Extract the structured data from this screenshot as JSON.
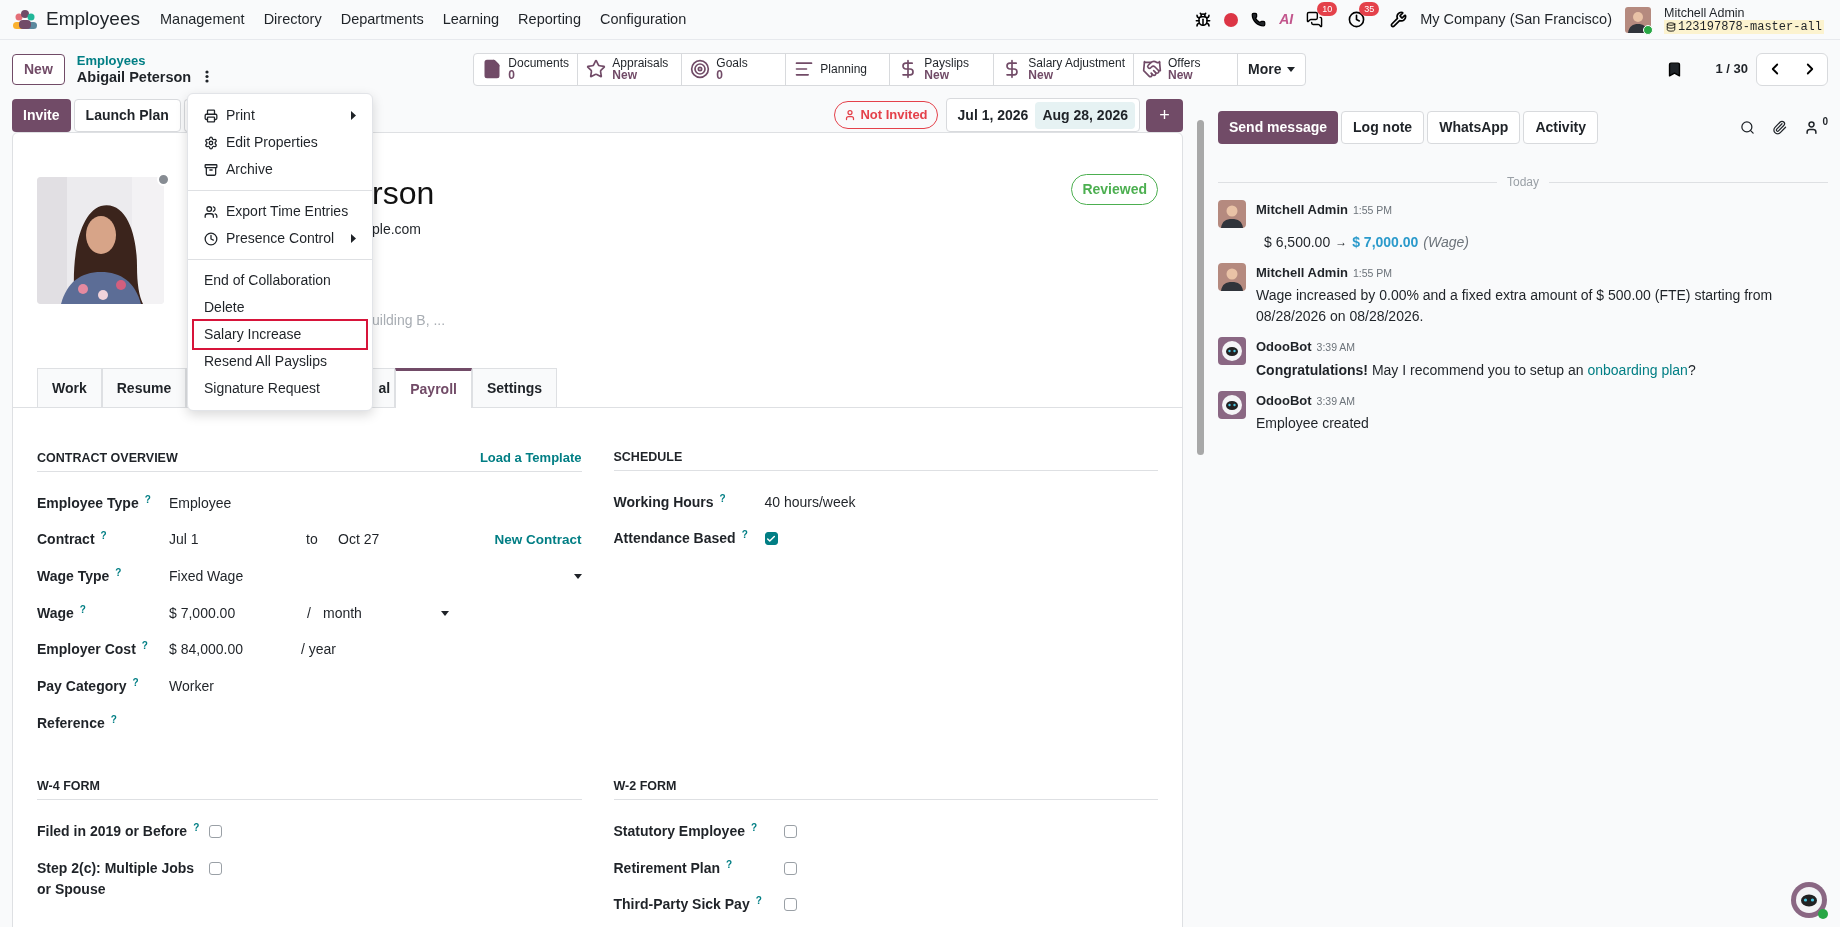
{
  "navbar": {
    "app_name": "Employees",
    "menu": [
      "Management",
      "Directory",
      "Departments",
      "Learning",
      "Reporting",
      "Configuration"
    ],
    "ai_label": "AI",
    "messages_count": "10",
    "activities_count": "35",
    "company": "My Company (San Francisco)",
    "user_name": "Mitchell Admin",
    "database": "123197878-master-all"
  },
  "control_panel": {
    "new_button": "New",
    "breadcrumb_parent": "Employees",
    "record_title": "Abigail Peterson",
    "smart_buttons": [
      {
        "label": "Documents",
        "value": "0",
        "kind": "document"
      },
      {
        "label": "Appraisals",
        "value": "New",
        "kind": "star"
      },
      {
        "label": "Goals",
        "value": "0",
        "kind": "target"
      },
      {
        "label": "Planning",
        "kind": "lines"
      },
      {
        "label": "Payslips",
        "value": "New",
        "kind": "dollar"
      },
      {
        "label": "Salary Adjustment",
        "value": "New",
        "kind": "dollar"
      },
      {
        "label": "Offers",
        "value": "New",
        "kind": "handshake"
      }
    ],
    "more_button": "More",
    "pager": "1 / 30"
  },
  "action_bar": {
    "buttons": [
      {
        "label": "Invite",
        "primary": true
      },
      {
        "label": "Launch Plan",
        "primary": false
      }
    ],
    "invite_status": "Not Invited",
    "date_start": "Jul 1, 2026",
    "date_end": "Aug 28, 2026",
    "add_button": "+"
  },
  "actions_menu": {
    "groups": [
      [
        {
          "label": "Print",
          "kind": "print",
          "submenu": true,
          "highlighted": false
        },
        {
          "label": "Edit Properties",
          "kind": "properties",
          "submenu": false,
          "highlighted": false
        },
        {
          "label": "Archive",
          "kind": "archive",
          "submenu": false,
          "highlighted": false
        }
      ],
      [
        {
          "label": "Export Time Entries",
          "kind": "people",
          "submenu": false,
          "highlighted": false
        },
        {
          "label": "Presence Control",
          "kind": "clock",
          "submenu": true,
          "highlighted": false
        }
      ],
      [
        {
          "label": "End of Collaboration",
          "kind": "plain",
          "submenu": false,
          "highlighted": false
        },
        {
          "label": "Delete",
          "kind": "plain",
          "submenu": false,
          "highlighted": false
        },
        {
          "label": "Salary Increase",
          "kind": "plain",
          "submenu": false,
          "highlighted": true
        },
        {
          "label": "Resend All Payslips",
          "kind": "plain",
          "submenu": false,
          "highlighted": false
        },
        {
          "label": "Signature Request",
          "kind": "plain",
          "submenu": false,
          "highlighted": false
        }
      ]
    ]
  },
  "employee": {
    "name_visible": "rson",
    "email_visible": "ple.com",
    "address_visible": "uilding B, ...",
    "status": "Reviewed"
  },
  "tabs": [
    {
      "label": "Work",
      "selected": false,
      "kind": "full"
    },
    {
      "label": "Resume",
      "selected": false,
      "kind": "full"
    },
    {
      "label": "al",
      "selected": false,
      "kind": "partial"
    },
    {
      "label": "Payroll",
      "selected": true,
      "kind": "full"
    },
    {
      "label": "Settings",
      "selected": false,
      "kind": "full"
    }
  ],
  "contract_overview": {
    "title": "CONTRACT OVERVIEW",
    "action": "Load a Template",
    "fields": [
      {
        "label": "Employee Type",
        "help": "?",
        "kind": "text",
        "value": "Employee"
      },
      {
        "label": "Contract",
        "help": "?",
        "kind": "range",
        "value": "Jul 1",
        "to_label": "to",
        "to": "Oct 27",
        "action": "New Contract"
      },
      {
        "label": "Wage Type",
        "help": "?",
        "kind": "select",
        "value": "Fixed Wage"
      },
      {
        "label": "Wage",
        "help": "?",
        "kind": "amount_select",
        "value": "$ 7,000.00",
        "separator": "/",
        "unit": "month"
      },
      {
        "label": "Employer Cost",
        "help": "?",
        "kind": "amount",
        "value": "$ 84,000.00",
        "unit": "/ year"
      },
      {
        "label": "Pay Category",
        "help": "?",
        "kind": "text",
        "value": "Worker"
      },
      {
        "label": "Reference",
        "help": "?",
        "kind": "text"
      }
    ]
  },
  "schedule": {
    "title": "SCHEDULE",
    "fields": [
      {
        "label": "Working Hours",
        "help": "?",
        "kind": "text",
        "value": "40 hours/week"
      },
      {
        "label": "Attendance Based",
        "help": "?",
        "kind": "checkbox",
        "checked": true
      }
    ]
  },
  "w4_form": {
    "title": "W-4 FORM",
    "fields": [
      {
        "label": "Filed in 2019 or Before",
        "help": "?",
        "kind": "checkbox",
        "checked": false
      },
      {
        "label": "Step 2(c): Multiple Jobs or Spouse",
        "kind": "checkbox",
        "checked": false
      }
    ]
  },
  "w2_form": {
    "title": "W-2 FORM",
    "fields": [
      {
        "label": "Statutory Employee",
        "help": "?",
        "kind": "checkbox",
        "checked": false
      },
      {
        "label": "Retirement Plan",
        "help": "?",
        "kind": "checkbox",
        "checked": false
      },
      {
        "label": "Third-Party Sick Pay",
        "help": "?",
        "kind": "checkbox",
        "checked": false
      }
    ]
  },
  "chatter": {
    "buttons": [
      {
        "label": "Send message",
        "primary": true
      },
      {
        "label": "Log note",
        "primary": false
      },
      {
        "label": "WhatsApp",
        "primary": false
      },
      {
        "label": "Activity",
        "primary": false
      }
    ],
    "followers_count": "0",
    "day_separator": "Today",
    "messages": [
      {
        "author": "Mitchell Admin",
        "time": "1:55 PM",
        "kind": "person",
        "old_value": "$ 6,500.00",
        "arrow": "→",
        "new_value": "$ 7,000.00",
        "field": "(Wage)"
      },
      {
        "author": "Mitchell Admin",
        "time": "1:55 PM",
        "kind": "person",
        "body": "Wage increased by 0.00% and a fixed extra amount of $ 500.00 (FTE) starting from 08/28/2026 on 08/28/2026."
      },
      {
        "author": "OdooBot",
        "time": "3:39 AM",
        "kind": "bot",
        "body": "**Congratulations!** May I recommend you to setup an ",
        "link": "onboarding plan",
        "body_end": "?"
      },
      {
        "author": "OdooBot",
        "time": "3:39 AM",
        "kind": "bot",
        "body": "Employee created"
      }
    ]
  }
}
